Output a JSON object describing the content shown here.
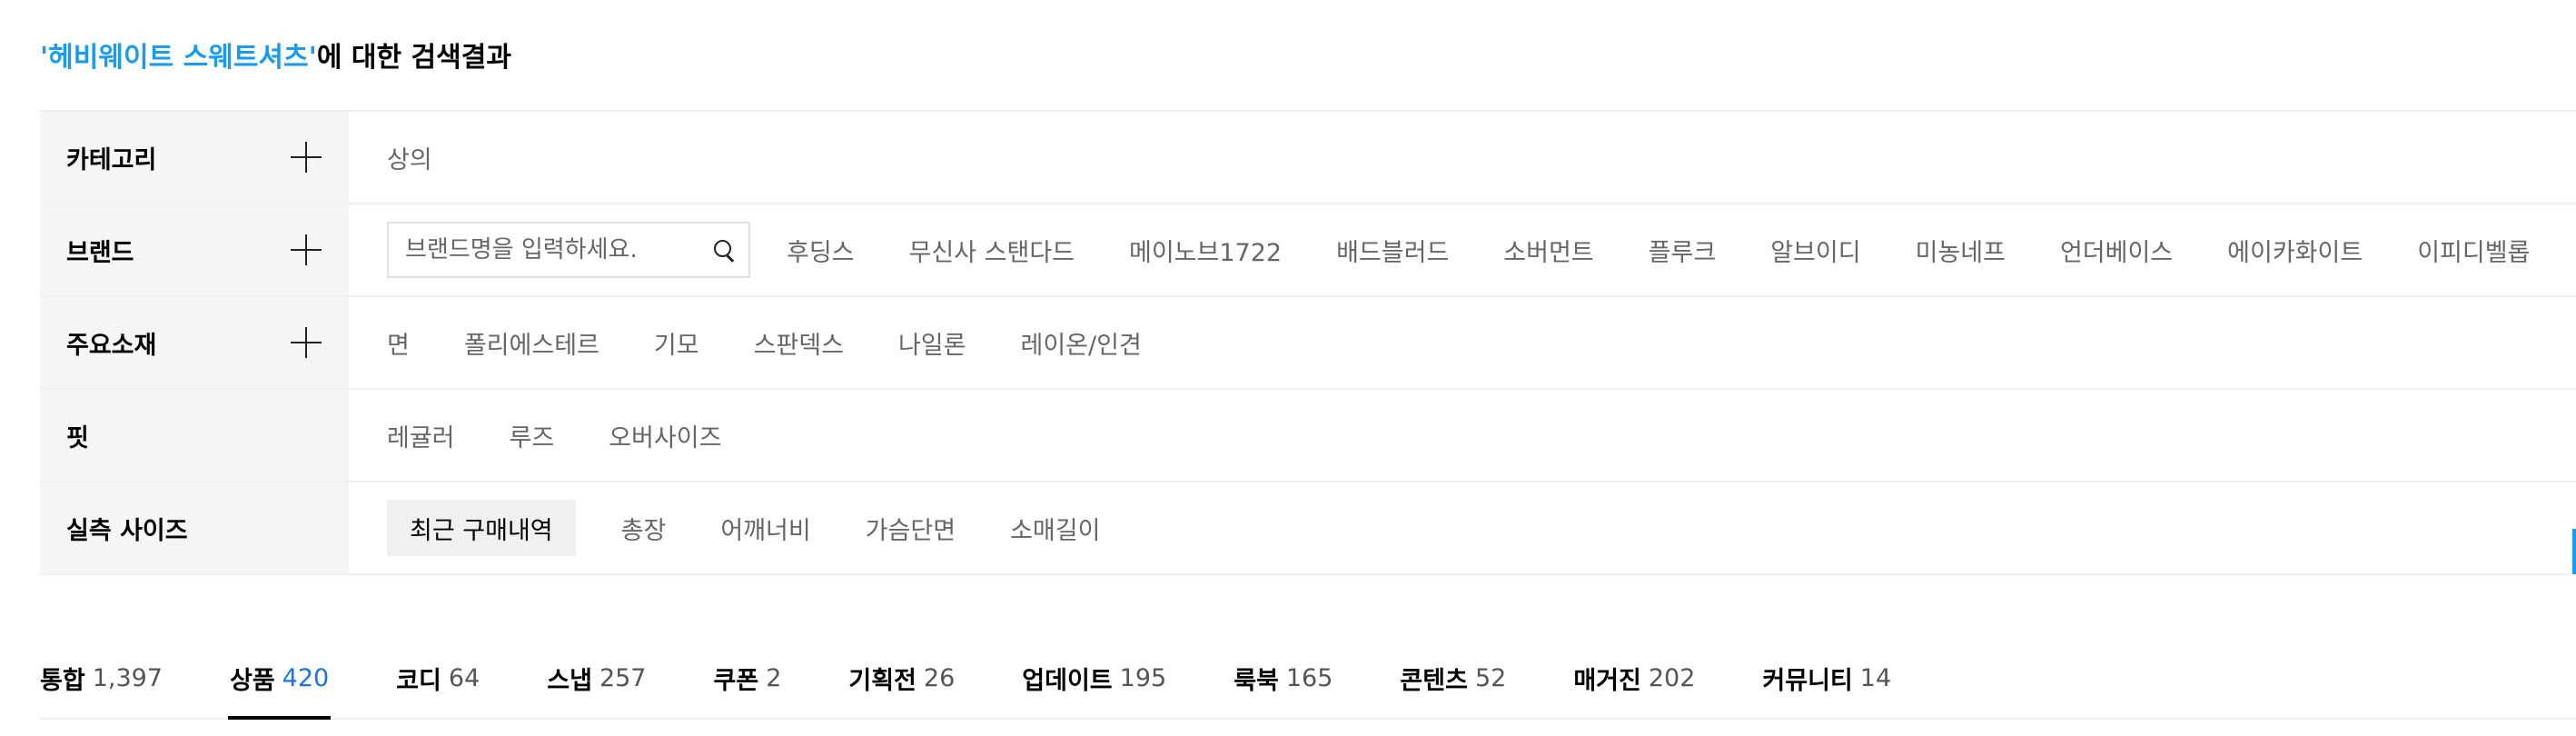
{
  "search_result": {
    "keyword": "'헤비웨이트 스웨트셔츠'",
    "suffix": "에 대한 검색결과"
  },
  "filters": {
    "category": {
      "label": "카테고리",
      "options": [
        "상의"
      ]
    },
    "brand": {
      "label": "브랜드",
      "search_placeholder": "브랜드명을 입력하세요.",
      "options": [
        "후딩스",
        "무신사 스탠다드",
        "메이노브1722",
        "배드블러드",
        "소버먼트",
        "플루크",
        "알브이디",
        "미농네프",
        "언더베이스",
        "에이카화이트",
        "이피디벨롭"
      ]
    },
    "material": {
      "label": "주요소재",
      "options": [
        "면",
        "폴리에스테르",
        "기모",
        "스판덱스",
        "나일론",
        "레이온/인견"
      ]
    },
    "fit": {
      "label": "핏",
      "options": [
        "레귤러",
        "루즈",
        "오버사이즈"
      ]
    },
    "size": {
      "label": "실측 사이즈",
      "options": [
        "최근 구매내역",
        "총장",
        "어깨너비",
        "가슴단면",
        "소매길이"
      ]
    }
  },
  "tabs": [
    {
      "label": "통합",
      "count": "1,397"
    },
    {
      "label": "상품",
      "count": "420"
    },
    {
      "label": "코디",
      "count": "64"
    },
    {
      "label": "스냅",
      "count": "257"
    },
    {
      "label": "쿠폰",
      "count": "2"
    },
    {
      "label": "기획전",
      "count": "26"
    },
    {
      "label": "업데이트",
      "count": "195"
    },
    {
      "label": "룩북",
      "count": "165"
    },
    {
      "label": "콘텐츠",
      "count": "52"
    },
    {
      "label": "매거진",
      "count": "202"
    },
    {
      "label": "커뮤니티",
      "count": "14"
    }
  ],
  "active_tab": "상품",
  "colors": {
    "accent": "#1a9bf0",
    "active_count": "#1a73e8",
    "header_bg": "#f5f5f5"
  }
}
